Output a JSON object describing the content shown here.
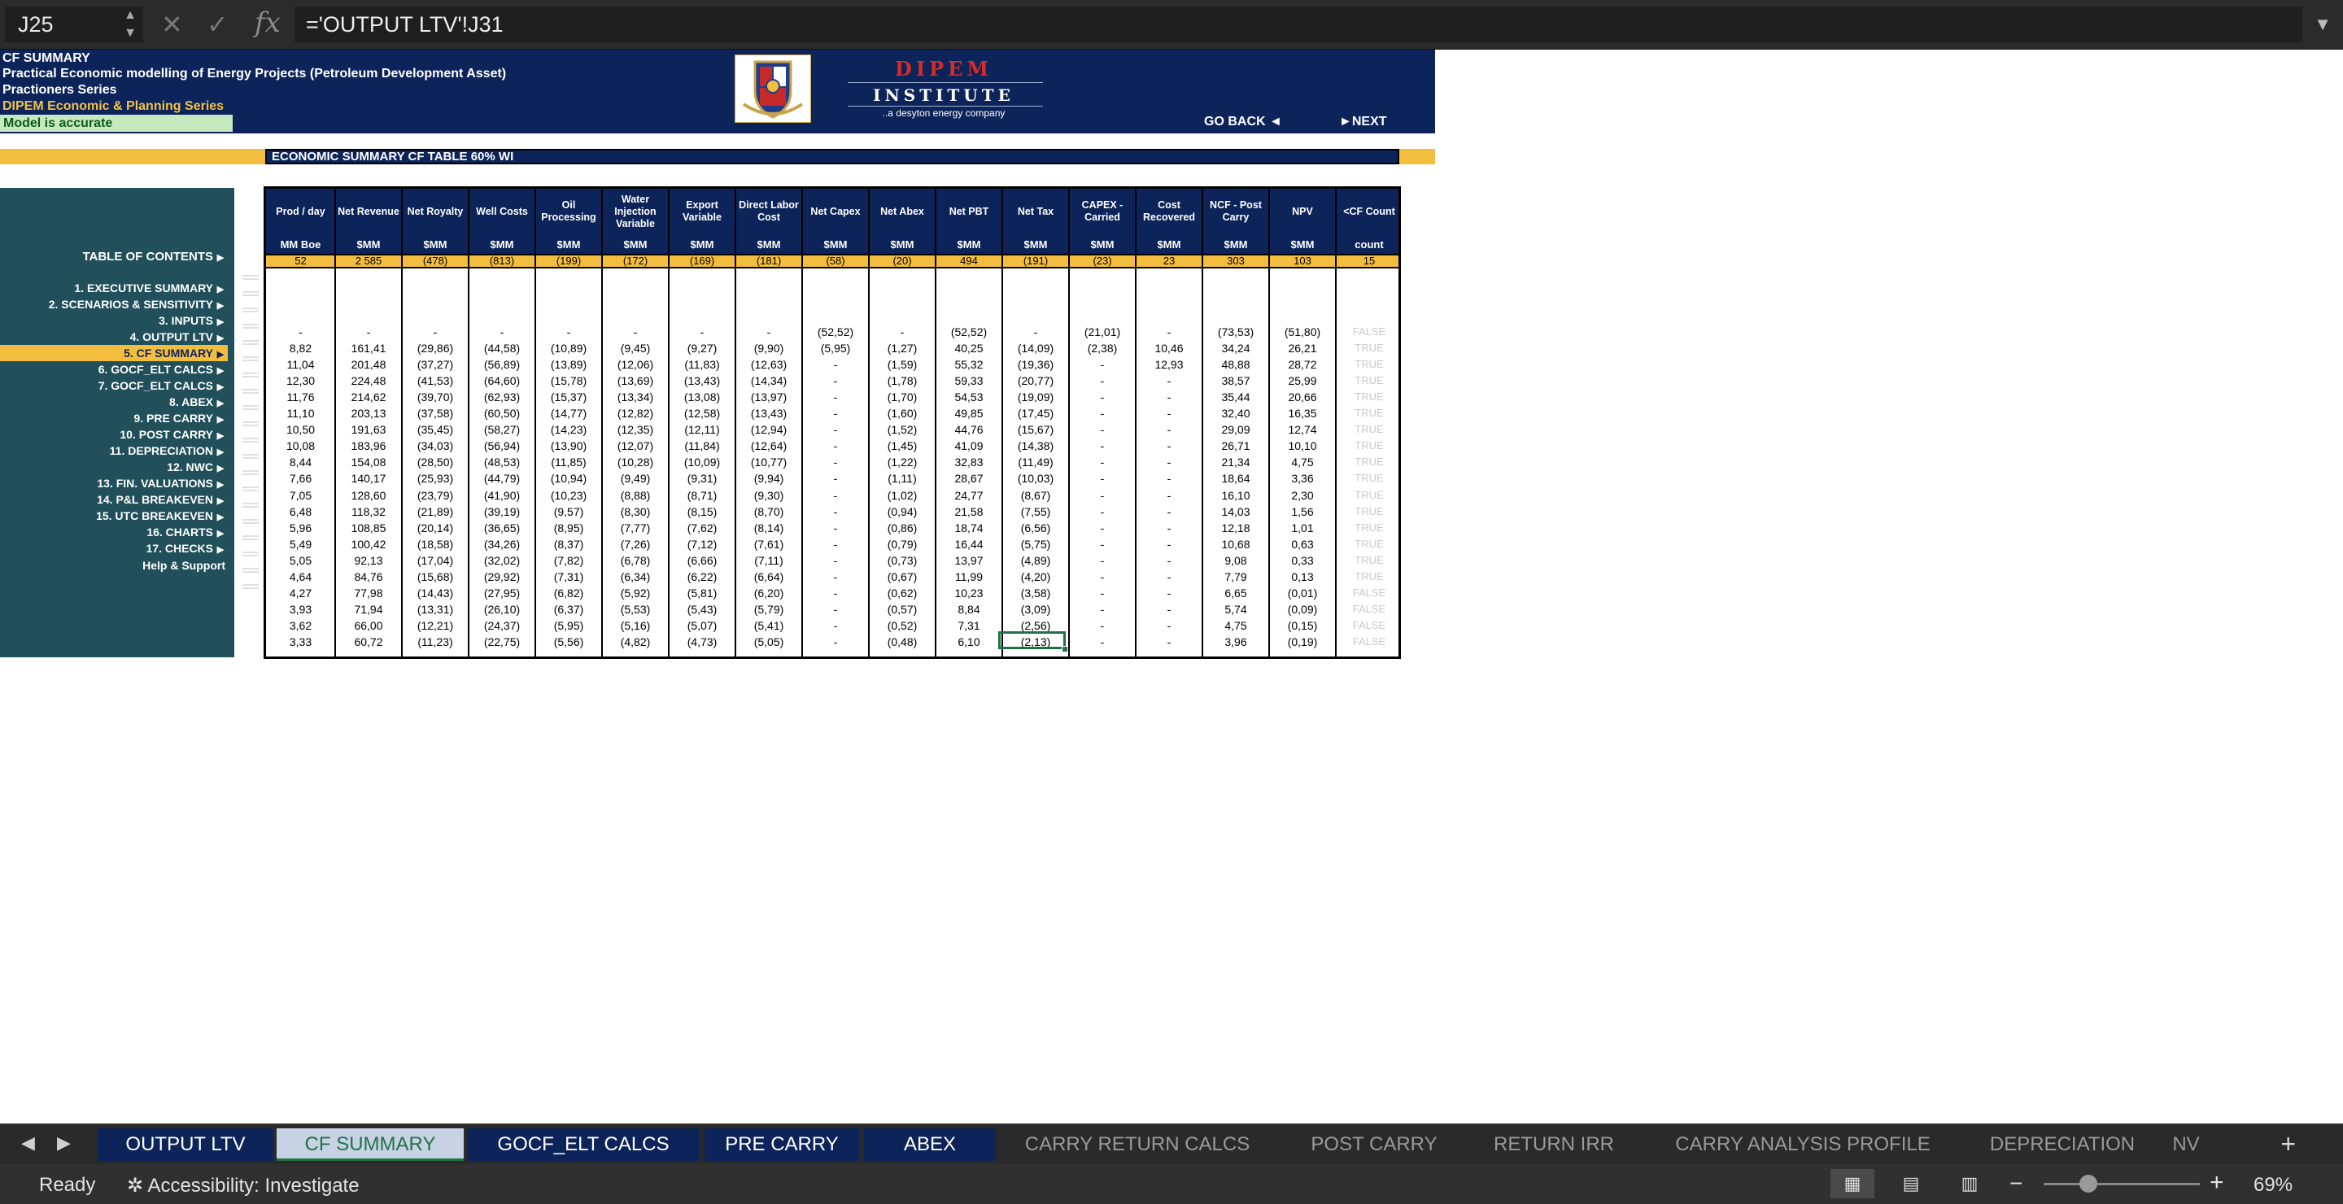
{
  "formula_bar": {
    "cell_ref": "J25",
    "formula": "='OUTPUT LTV'!J31"
  },
  "banner": {
    "line1": "CF SUMMARY",
    "line2": "Practical Economic modelling of Energy Projects (Petroleum Development Asset)",
    "line3": "Practioners Series",
    "line4": "DIPEM Economic & Planning Series",
    "status": "Model is accurate",
    "logo_name": "DIPEM",
    "logo_sub": "INSTITUTE",
    "logo_tag": "..a desyton energy company",
    "go_back": "GO BACK ◄",
    "next": "►NEXT"
  },
  "table_title": "ECONOMIC SUMMARY CF TABLE 60% WI",
  "toc": {
    "title": "TABLE OF CONTENTS",
    "items": [
      "1.  EXECUTIVE SUMMARY",
      "2.  SCENARIOS & SENSITIVITY",
      "3.  INPUTS",
      "4.  OUTPUT LTV",
      "5.  CF SUMMARY",
      "6.  GOCF_ELT CALCS",
      "7.  GOCF_ELT CALCS",
      "8.  ABEX",
      "9.  PRE CARRY",
      "10.  POST CARRY",
      "11.  DEPRECIATION",
      "12.  NWC",
      "13.  FIN. VALUATIONS",
      "14.  P&L BREAKEVEN",
      "15.  UTC BREAKEVEN",
      "16.  CHARTS",
      "17.  CHECKS"
    ],
    "active_index": 4,
    "help": "Help & Support"
  },
  "columns": [
    {
      "h": "Prod / day",
      "u": "MM Boe",
      "s": "52"
    },
    {
      "h": "Net Revenue",
      "u": "$MM",
      "s": "2 585"
    },
    {
      "h": "Net Royalty",
      "u": "$MM",
      "s": "(478)"
    },
    {
      "h": "Well Costs",
      "u": "$MM",
      "s": "(813)"
    },
    {
      "h": "Oil Processing",
      "u": "$MM",
      "s": "(199)"
    },
    {
      "h": "Water Injection Variable",
      "u": "$MM",
      "s": "(172)"
    },
    {
      "h": "Export Variable",
      "u": "$MM",
      "s": "(169)"
    },
    {
      "h": "Direct Labor Cost",
      "u": "$MM",
      "s": "(181)"
    },
    {
      "h": "Net  Capex",
      "u": "$MM",
      "s": "(58)"
    },
    {
      "h": "Net Abex",
      "u": "$MM",
      "s": "(20)"
    },
    {
      "h": "Net PBT",
      "u": "$MM",
      "s": "494"
    },
    {
      "h": "Net Tax",
      "u": "$MM",
      "s": "(191)"
    },
    {
      "h": "CAPEX - Carried",
      "u": "$MM",
      "s": "(23)"
    },
    {
      "h": "Cost Recovered",
      "u": "$MM",
      "s": "23"
    },
    {
      "h": "NCF - Post Carry",
      "u": "$MM",
      "s": "303"
    },
    {
      "h": "NPV",
      "u": "$MM",
      "s": "103"
    },
    {
      "h": "<CF Count",
      "u": "count",
      "s": "15"
    }
  ],
  "rows": [
    [
      "-",
      "-",
      "-",
      "-",
      "-",
      "-",
      "-",
      "-",
      "(52,52)",
      "-",
      "(52,52)",
      "-",
      "(21,01)",
      "-",
      "(73,53)",
      "(51,80)",
      "FALSE"
    ],
    [
      "8,82",
      "161,41",
      "(29,86)",
      "(44,58)",
      "(10,89)",
      "(9,45)",
      "(9,27)",
      "(9,90)",
      "(5,95)",
      "(1,27)",
      "40,25",
      "(14,09)",
      "(2,38)",
      "10,46",
      "34,24",
      "26,21",
      "TRUE"
    ],
    [
      "11,04",
      "201,48",
      "(37,27)",
      "(56,89)",
      "(13,89)",
      "(12,06)",
      "(11,83)",
      "(12,63)",
      "-",
      "(1,59)",
      "55,32",
      "(19,36)",
      "-",
      "12,93",
      "48,88",
      "28,72",
      "TRUE"
    ],
    [
      "12,30",
      "224,48",
      "(41,53)",
      "(64,60)",
      "(15,78)",
      "(13,69)",
      "(13,43)",
      "(14,34)",
      "-",
      "(1,78)",
      "59,33",
      "(20,77)",
      "-",
      "-",
      "38,57",
      "25,99",
      "TRUE"
    ],
    [
      "11,76",
      "214,62",
      "(39,70)",
      "(62,93)",
      "(15,37)",
      "(13,34)",
      "(13,08)",
      "(13,97)",
      "-",
      "(1,70)",
      "54,53",
      "(19,09)",
      "-",
      "-",
      "35,44",
      "20,66",
      "TRUE"
    ],
    [
      "11,10",
      "203,13",
      "(37,58)",
      "(60,50)",
      "(14,77)",
      "(12,82)",
      "(12,58)",
      "(13,43)",
      "-",
      "(1,60)",
      "49,85",
      "(17,45)",
      "-",
      "-",
      "32,40",
      "16,35",
      "TRUE"
    ],
    [
      "10,50",
      "191,63",
      "(35,45)",
      "(58,27)",
      "(14,23)",
      "(12,35)",
      "(12,11)",
      "(12,94)",
      "-",
      "(1,52)",
      "44,76",
      "(15,67)",
      "-",
      "-",
      "29,09",
      "12,74",
      "TRUE"
    ],
    [
      "10,08",
      "183,96",
      "(34,03)",
      "(56,94)",
      "(13,90)",
      "(12,07)",
      "(11,84)",
      "(12,64)",
      "-",
      "(1,45)",
      "41,09",
      "(14,38)",
      "-",
      "-",
      "26,71",
      "10,10",
      "TRUE"
    ],
    [
      "8,44",
      "154,08",
      "(28,50)",
      "(48,53)",
      "(11,85)",
      "(10,28)",
      "(10,09)",
      "(10,77)",
      "-",
      "(1,22)",
      "32,83",
      "(11,49)",
      "-",
      "-",
      "21,34",
      "4,75",
      "TRUE"
    ],
    [
      "7,66",
      "140,17",
      "(25,93)",
      "(44,79)",
      "(10,94)",
      "(9,49)",
      "(9,31)",
      "(9,94)",
      "-",
      "(1,11)",
      "28,67",
      "(10,03)",
      "-",
      "-",
      "18,64",
      "3,36",
      "TRUE"
    ],
    [
      "7,05",
      "128,60",
      "(23,79)",
      "(41,90)",
      "(10,23)",
      "(8,88)",
      "(8,71)",
      "(9,30)",
      "-",
      "(1,02)",
      "24,77",
      "(8,67)",
      "-",
      "-",
      "16,10",
      "2,30",
      "TRUE"
    ],
    [
      "6,48",
      "118,32",
      "(21,89)",
      "(39,19)",
      "(9,57)",
      "(8,30)",
      "(8,15)",
      "(8,70)",
      "-",
      "(0,94)",
      "21,58",
      "(7,55)",
      "-",
      "-",
      "14,03",
      "1,56",
      "TRUE"
    ],
    [
      "5,96",
      "108,85",
      "(20,14)",
      "(36,65)",
      "(8,95)",
      "(7,77)",
      "(7,62)",
      "(8,14)",
      "-",
      "(0,86)",
      "18,74",
      "(6,56)",
      "-",
      "-",
      "12,18",
      "1,01",
      "TRUE"
    ],
    [
      "5,49",
      "100,42",
      "(18,58)",
      "(34,26)",
      "(8,37)",
      "(7,26)",
      "(7,12)",
      "(7,61)",
      "-",
      "(0,79)",
      "16,44",
      "(5,75)",
      "-",
      "-",
      "10,68",
      "0,63",
      "TRUE"
    ],
    [
      "5,05",
      "92,13",
      "(17,04)",
      "(32,02)",
      "(7,82)",
      "(6,78)",
      "(6,66)",
      "(7,11)",
      "-",
      "(0,73)",
      "13,97",
      "(4,89)",
      "-",
      "-",
      "9,08",
      "0,33",
      "TRUE"
    ],
    [
      "4,64",
      "84,76",
      "(15,68)",
      "(29,92)",
      "(7,31)",
      "(6,34)",
      "(6,22)",
      "(6,64)",
      "-",
      "(0,67)",
      "11,99",
      "(4,20)",
      "-",
      "-",
      "7,79",
      "0,13",
      "TRUE"
    ],
    [
      "4,27",
      "77,98",
      "(14,43)",
      "(27,95)",
      "(6,82)",
      "(5,92)",
      "(5,81)",
      "(6,20)",
      "-",
      "(0,62)",
      "10,23",
      "(3,58)",
      "-",
      "-",
      "6,65",
      "(0,01)",
      "FALSE"
    ],
    [
      "3,93",
      "71,94",
      "(13,31)",
      "(26,10)",
      "(6,37)",
      "(5,53)",
      "(5,43)",
      "(5,79)",
      "-",
      "(0,57)",
      "8,84",
      "(3,09)",
      "-",
      "-",
      "5,74",
      "(0,09)",
      "FALSE"
    ],
    [
      "3,62",
      "66,00",
      "(12,21)",
      "(24,37)",
      "(5,95)",
      "(5,16)",
      "(5,07)",
      "(5,41)",
      "-",
      "(0,52)",
      "7,31",
      "(2,56)",
      "-",
      "-",
      "4,75",
      "(0,15)",
      "FALSE"
    ],
    [
      "3,33",
      "60,72",
      "(11,23)",
      "(22,75)",
      "(5,56)",
      "(4,82)",
      "(4,73)",
      "(5,05)",
      "-",
      "(0,48)",
      "6,10",
      "(2,13)",
      "-",
      "-",
      "3,96",
      "(0,19)",
      "FALSE"
    ]
  ],
  "tabs": [
    "OUTPUT LTV",
    "CF SUMMARY",
    "GOCF_ELT CALCS",
    "PRE CARRY",
    "ABEX",
    "CARRY RETURN CALCS",
    "POST CARRY",
    "RETURN IRR",
    "CARRY ANALYSIS PROFILE",
    "DEPRECIATION",
    "NV"
  ],
  "active_tab": "CF SUMMARY",
  "status": {
    "ready": "Ready",
    "accessibility": "Accessibility: Investigate",
    "zoom": "69%"
  },
  "colors": {
    "navy": "#0c2459",
    "gold": "#f3bd3f",
    "teal": "#21505b",
    "excel_green": "#207245"
  }
}
